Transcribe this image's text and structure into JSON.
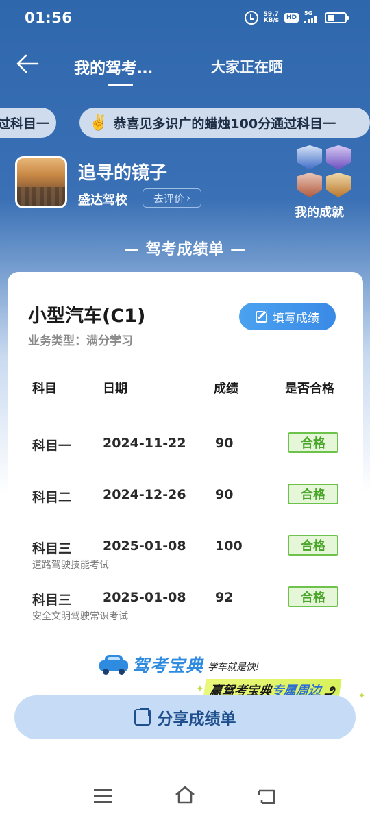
{
  "status_bar": {
    "time": "01:56",
    "net_speed": "59.7",
    "net_unit": "KB/s",
    "hd": "HD",
    "signal": "5G"
  },
  "nav": {
    "tab_active": "我的驾考…",
    "tab_other": "大家正在晒"
  },
  "ticker": {
    "prev_text": "过科目一",
    "text": "恭喜见多识广的蜡烛100分通过科目一",
    "emoji": "✌️"
  },
  "profile": {
    "name": "追寻的镜子",
    "school": "盛达驾校",
    "rate_label": "去评价",
    "achievements_label": "我的成就"
  },
  "section_title": "— 驾考成绩单 —",
  "card": {
    "vehicle": "小型汽车(C1)",
    "business_type": "业务类型：满分学习",
    "fill_button": "填写成绩",
    "headers": [
      "科目",
      "日期",
      "成绩",
      "是否合格"
    ],
    "rows": [
      {
        "subject": "科目一",
        "date": "2024-11-22",
        "score": "90",
        "result": "合格",
        "note": ""
      },
      {
        "subject": "科目二",
        "date": "2024-12-26",
        "score": "90",
        "result": "合格",
        "note": ""
      },
      {
        "subject": "科目三",
        "date": "2025-01-08",
        "score": "100",
        "result": "合格",
        "note": "道路驾驶技能考试"
      },
      {
        "subject": "科目三",
        "date": "2025-01-08",
        "score": "92",
        "result": "合格",
        "note": "安全文明驾驶常识考试"
      }
    ],
    "brand_name": "驾考宝典",
    "brand_slogan": "学车就是快!"
  },
  "promo": {
    "part1": "赢驾考宝典",
    "part2": "专属周边"
  },
  "share_button": "分享成绩单",
  "colors": {
    "header_blue": "#2f67ad",
    "accent_blue": "#3a8ae6",
    "pass_green": "#4aa62a"
  }
}
